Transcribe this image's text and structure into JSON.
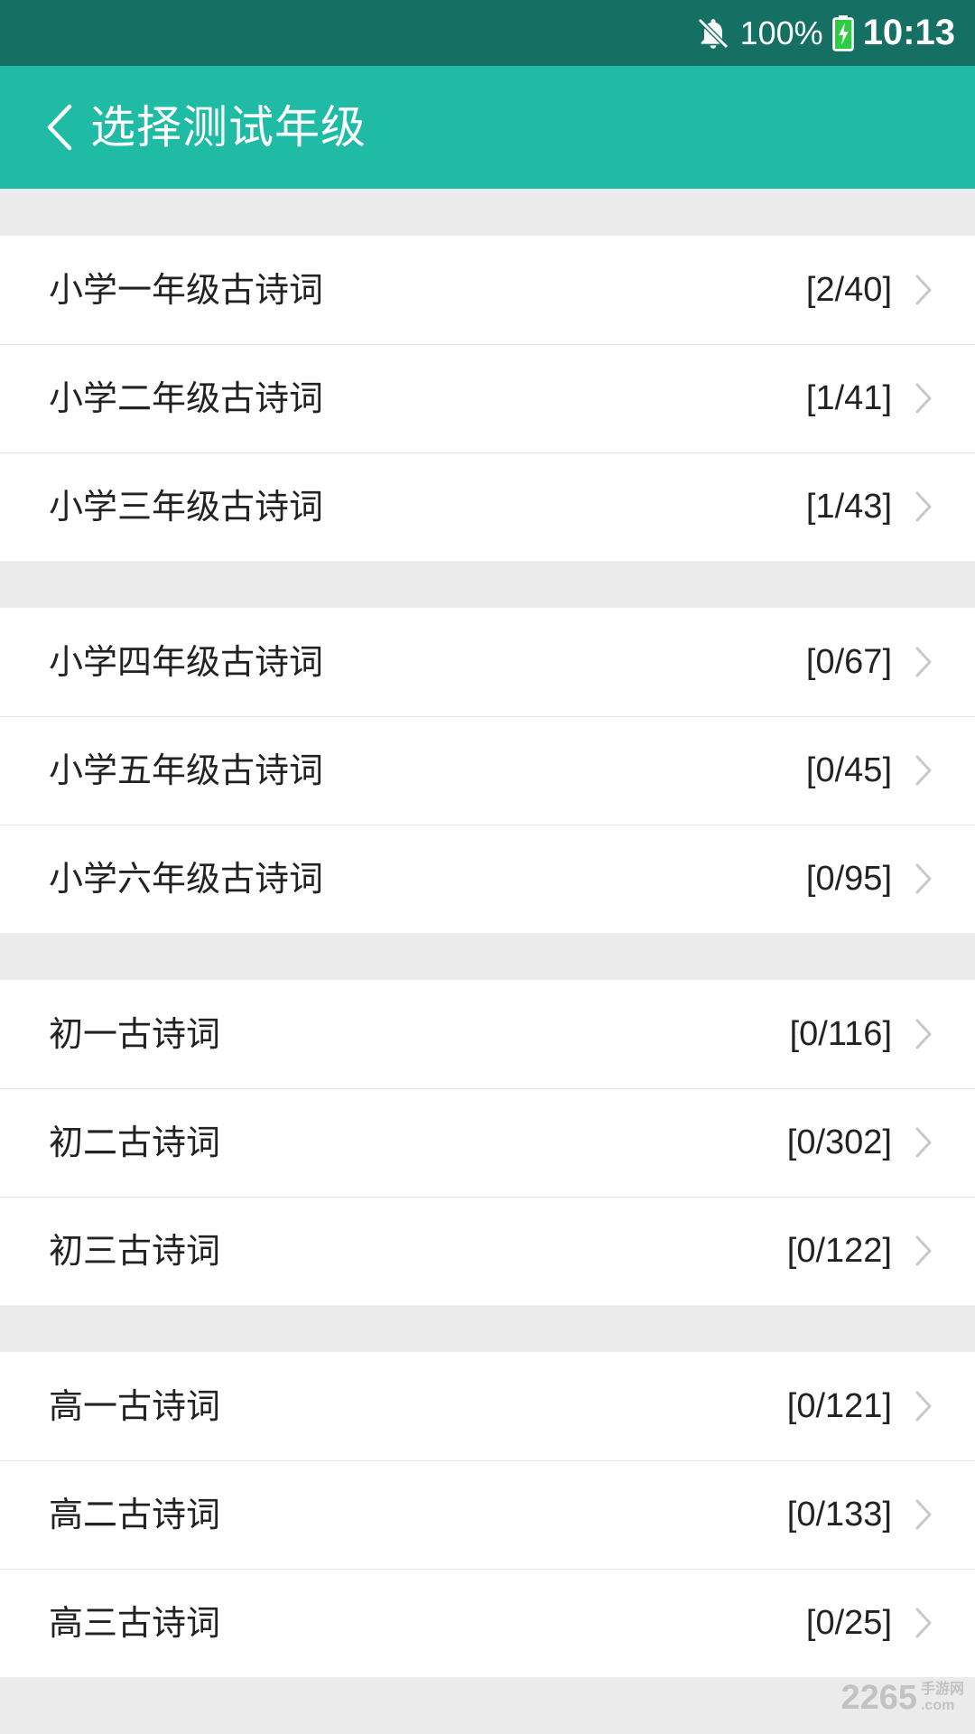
{
  "status_bar": {
    "battery": "100%",
    "time": "10:13"
  },
  "app_bar": {
    "title": "选择测试年级"
  },
  "groups": [
    {
      "rows": [
        {
          "label": "小学一年级古诗词",
          "count": "[2/40]"
        },
        {
          "label": "小学二年级古诗词",
          "count": "[1/41]"
        },
        {
          "label": "小学三年级古诗词",
          "count": "[1/43]"
        }
      ]
    },
    {
      "rows": [
        {
          "label": "小学四年级古诗词",
          "count": "[0/67]"
        },
        {
          "label": "小学五年级古诗词",
          "count": "[0/45]"
        },
        {
          "label": "小学六年级古诗词",
          "count": "[0/95]"
        }
      ]
    },
    {
      "rows": [
        {
          "label": "初一古诗词",
          "count": "[0/116]"
        },
        {
          "label": "初二古诗词",
          "count": "[0/302]"
        },
        {
          "label": "初三古诗词",
          "count": "[0/122]"
        }
      ]
    },
    {
      "rows": [
        {
          "label": "高一古诗词",
          "count": "[0/121]"
        },
        {
          "label": "高二古诗词",
          "count": "[0/133]"
        },
        {
          "label": "高三古诗词",
          "count": "[0/25]"
        }
      ]
    }
  ],
  "watermark": {
    "main": "2265",
    "top": "手游网",
    "bottom": ".com"
  },
  "colors": {
    "status_bar": "#157063",
    "app_bar": "#20bba4",
    "background": "#ebebeb"
  },
  "icons": {
    "back": "chevron-left-icon",
    "row": "chevron-right-icon",
    "bell": "bell-off-icon",
    "battery": "battery-charging-icon"
  }
}
